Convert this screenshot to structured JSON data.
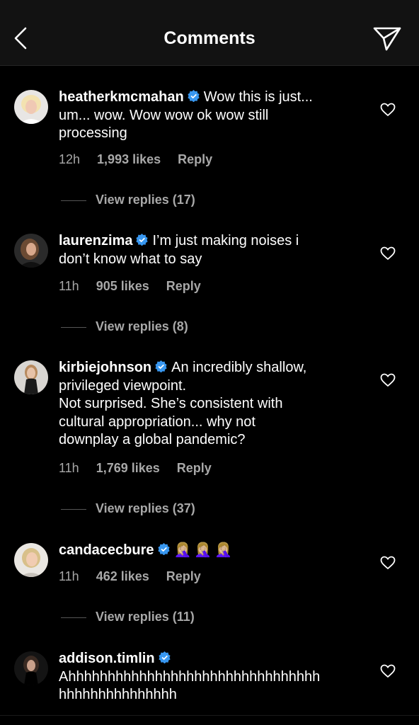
{
  "header": {
    "title": "Comments",
    "back_icon": "back-chevron-icon",
    "share_icon": "paper-plane-icon"
  },
  "colors": {
    "background": "#000000",
    "header_bg": "#121212",
    "secondary_text": "#a8a8a8",
    "verified_blue": "#3897f0"
  },
  "comments": [
    {
      "username": "heatherkmcmahan",
      "verified": true,
      "text_lines": [
        "Wow this is just...",
        "um... wow. Wow wow ok wow still",
        "processing"
      ],
      "time": "12h",
      "likes": "1,993 likes",
      "reply_label": "Reply",
      "view_replies": "View replies (17)"
    },
    {
      "username": "laurenzima",
      "verified": true,
      "text_lines": [
        "I’m just making noises i",
        "don’t know what to say"
      ],
      "time": "11h",
      "likes": "905 likes",
      "reply_label": "Reply",
      "view_replies": "View replies (8)"
    },
    {
      "username": "kirbiejohnson",
      "verified": true,
      "text_lines": [
        "An incredibly shallow,",
        "privileged viewpoint.",
        "Not surprised. She’s consistent with",
        "cultural appropriation... why not",
        "downplay a global pandemic?"
      ],
      "time": "11h",
      "likes": "1,769 likes",
      "reply_label": "Reply",
      "view_replies": "View replies (37)"
    },
    {
      "username": "candacecbure",
      "verified": true,
      "text_lines": [
        "🤦🏼‍♀️🤦🏼‍♀️🤦🏼‍♀️"
      ],
      "time": "11h",
      "likes": "462 likes",
      "reply_label": "Reply",
      "view_replies": "View replies (11)"
    },
    {
      "username": "addison.timlin",
      "verified": true,
      "text_lines": [
        "",
        "Ahhhhhhhhhhhhhhhhhhhhhhhhhhhhhhhh",
        "hhhhhhhhhhhhhhh"
      ]
    }
  ]
}
